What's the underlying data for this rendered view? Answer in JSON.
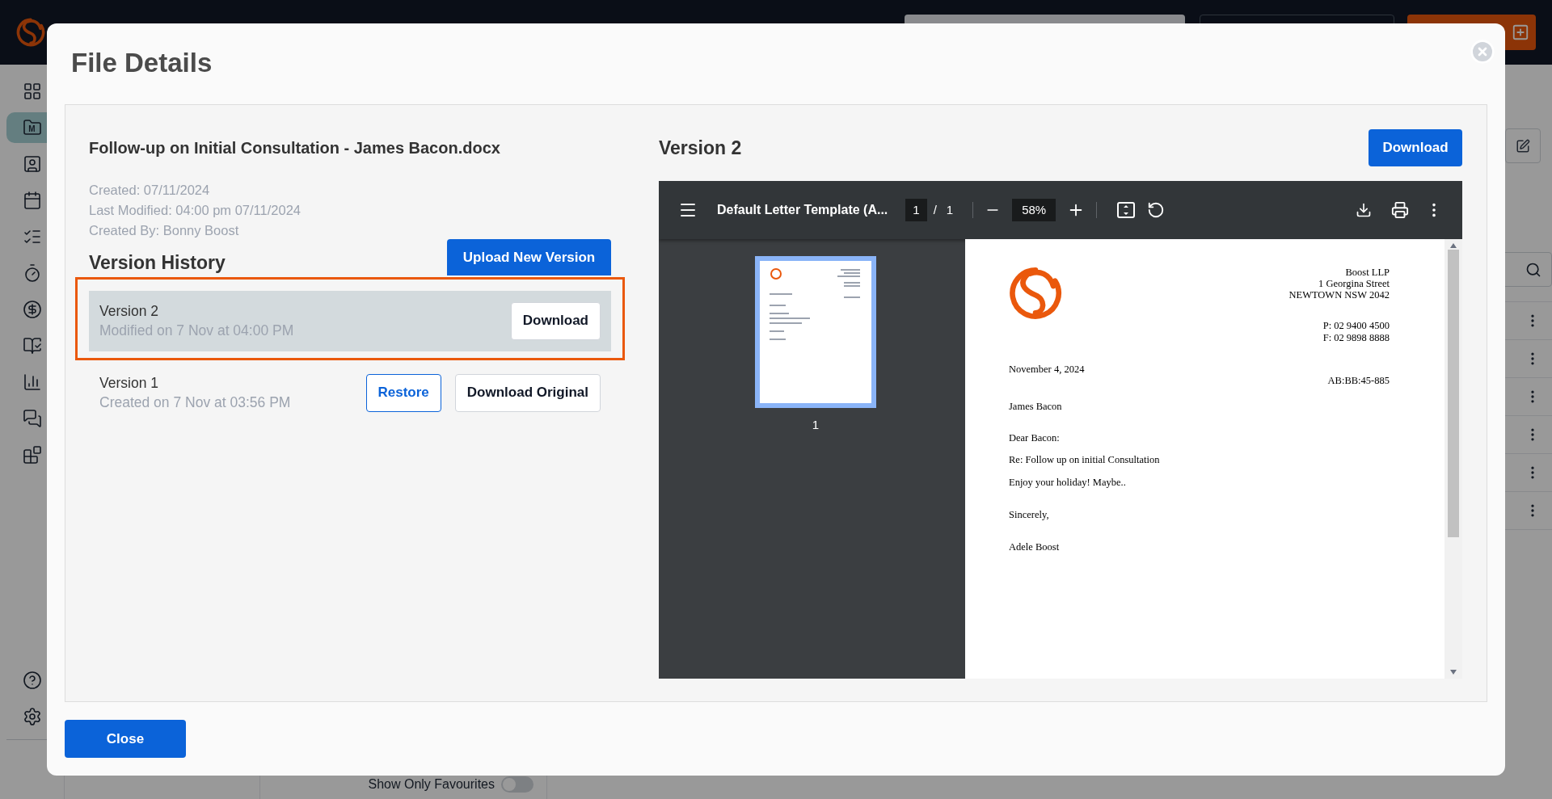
{
  "app": {
    "sidebar": {
      "items": [
        {
          "selected": false
        },
        {
          "selected": true,
          "badge": "M"
        },
        {
          "selected": false
        },
        {
          "selected": false
        },
        {
          "selected": false
        },
        {
          "selected": false
        },
        {
          "selected": false
        },
        {
          "selected": false
        },
        {
          "selected": false
        },
        {
          "selected": false
        },
        {
          "selected": false
        }
      ]
    },
    "favourites_toggle": {
      "label": "Show Only Favourites",
      "on": false
    }
  },
  "dialog": {
    "title": "File Details",
    "file": {
      "name": "Follow-up on Initial Consultation - James Bacon.docx",
      "meta": [
        "Created: 07/11/2024",
        "Last Modified: 04:00 pm 07/11/2024",
        "Created By: Bonny Boost"
      ]
    },
    "version_history": {
      "title": "Version History",
      "upload_button": "Upload New Version",
      "versions": [
        {
          "label": "Version 2",
          "detail": "Modified on 7 Nov at 04:00 PM",
          "selected": true,
          "buttons": [
            {
              "kind": "secondary",
              "label": "Download"
            }
          ]
        },
        {
          "label": "Version 1",
          "detail": "Created on 7 Nov at 03:56 PM",
          "selected": false,
          "buttons": [
            {
              "kind": "outline",
              "label": "Restore"
            },
            {
              "kind": "secondary",
              "label": "Download Original"
            }
          ]
        }
      ]
    },
    "preview": {
      "title": "Version 2",
      "download_button": "Download",
      "viewer": {
        "document_title": "Default Letter Template (A...",
        "page": "1",
        "separator": "/",
        "page_count": "1",
        "zoom": "58%",
        "thumbnails": [
          {
            "label": "1",
            "selected": true
          }
        ],
        "letter": {
          "sender": [
            "Boost LLP",
            "1 Georgina Street",
            "NEWTOWN NSW 2042"
          ],
          "contact": [
            "P: 02 9400 4500",
            "F: 02 9898 8888"
          ],
          "date": "November 4, 2024",
          "reference": "AB:BB:45-885",
          "recipient": "James Bacon",
          "salutation": "Dear Bacon:",
          "subject": "Re: Follow up on initial Consultation",
          "body": "Enjoy your holiday! Maybe..",
          "closing": "Sincerely,",
          "signature": "Adele Boost"
        }
      }
    },
    "close_button": "Close"
  }
}
